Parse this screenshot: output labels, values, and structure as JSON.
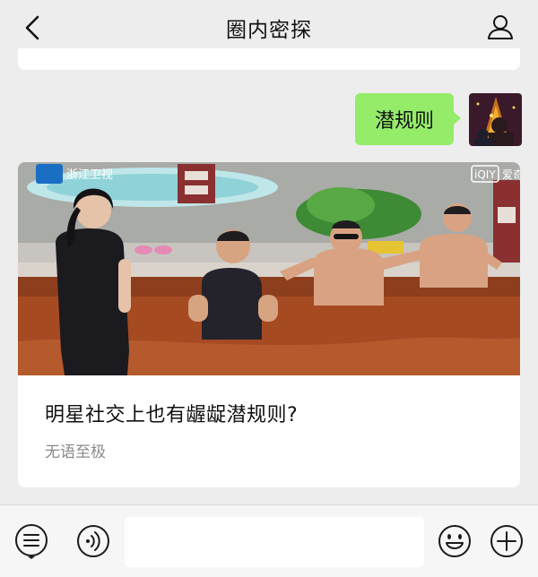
{
  "header": {
    "title": "圈内密探",
    "back_icon": "chevron-left-icon",
    "profile_icon": "person-icon"
  },
  "message": {
    "text": "潜规则",
    "bubble_color": "#95ec69"
  },
  "article_card": {
    "headline": "明星社交上也有龌龊潜规则?",
    "source": "无语至极",
    "thumbnail_watermarks": [
      "浙江卫视",
      "爱奇艺"
    ]
  },
  "input_bar": {
    "value": "",
    "menu_icon": "service-menu-icon",
    "voice_icon": "voice-icon",
    "emoji_icon": "emoji-icon",
    "plus_icon": "plus-icon"
  }
}
